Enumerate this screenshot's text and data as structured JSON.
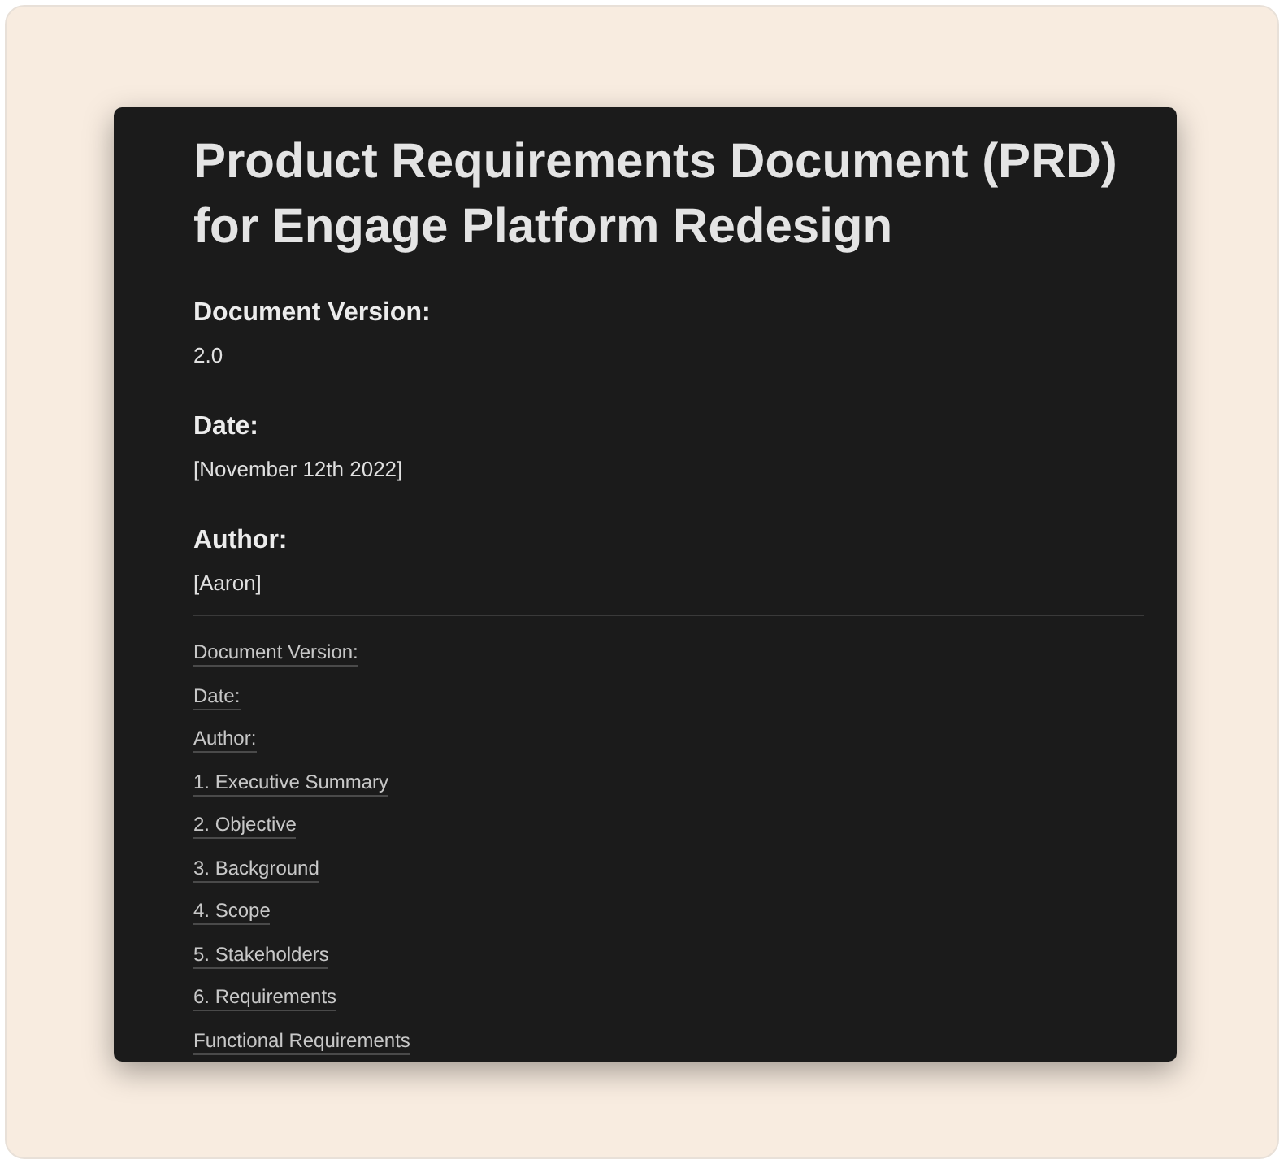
{
  "document": {
    "title": "Product Requirements Document (PRD) for Engage Platform Redesign",
    "fields": [
      {
        "label": "Document Version:",
        "value": "2.0"
      },
      {
        "label": "Date:",
        "value": "[November 12th 2022]"
      },
      {
        "label": "Author:",
        "value": "[Aaron]"
      }
    ],
    "toc": [
      "Document Version:",
      "Date:",
      "Author:",
      "1. Executive Summary",
      "2. Objective",
      "3. Background",
      "4. Scope",
      "5. Stakeholders",
      "6. Requirements",
      "Functional Requirements"
    ]
  }
}
